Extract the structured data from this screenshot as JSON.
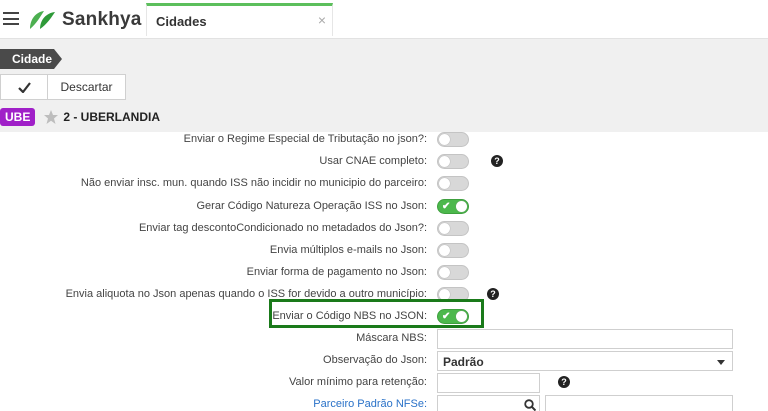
{
  "header": {
    "app_name": "Sankhya",
    "tab_label": "Cidades",
    "tab_close": "×"
  },
  "breadcrumb": {
    "label": "Cidade"
  },
  "toolbar": {
    "confirm_icon": "check-icon",
    "discard_label": "Descartar"
  },
  "record": {
    "badge": "UBE",
    "title": "2 - UBERLANDIA",
    "colors": {
      "badge": "#a020c8"
    }
  },
  "settings": [
    {
      "label": "Enviar o Regime Especial de Tributação no json?:",
      "on": false
    },
    {
      "label": "Usar CNAE completo:",
      "on": false,
      "help": true
    },
    {
      "label": "Não enviar insc. mun. quando ISS não incidir no municipio do parceiro:",
      "on": false
    },
    {
      "label": "Gerar Código Natureza Operação ISS no Json:",
      "on": true
    },
    {
      "label": "Enviar tag descontoCondicionado no metadados do Json?:",
      "on": false
    },
    {
      "label": "Envia múltiplos e-mails no Json:",
      "on": false
    },
    {
      "label": "Enviar forma de pagamento no Json:",
      "on": false
    },
    {
      "label": "Envia aliquota no Json apenas quando o ISS for devido a outro município:",
      "on": false,
      "help": true
    },
    {
      "label": "Enviar o Código NBS no JSON:",
      "on": true,
      "highlighted": true
    }
  ],
  "fields": {
    "mascara_nbs": {
      "label": "Máscara NBS:",
      "value": ""
    },
    "observacao_json": {
      "label": "Observação do Json:",
      "value": "Padrão"
    },
    "valor_minimo": {
      "label": "Valor mínimo para retenção:",
      "value": ""
    },
    "parceiro_padrao": {
      "label": "Parceiro Padrão NFSe:",
      "value": ""
    }
  },
  "colors": {
    "toggle_on": "#4cb84c",
    "highlight_border": "#1a7a1a",
    "tab_accent": "#5cbf5c",
    "link": "#2a72c8"
  }
}
